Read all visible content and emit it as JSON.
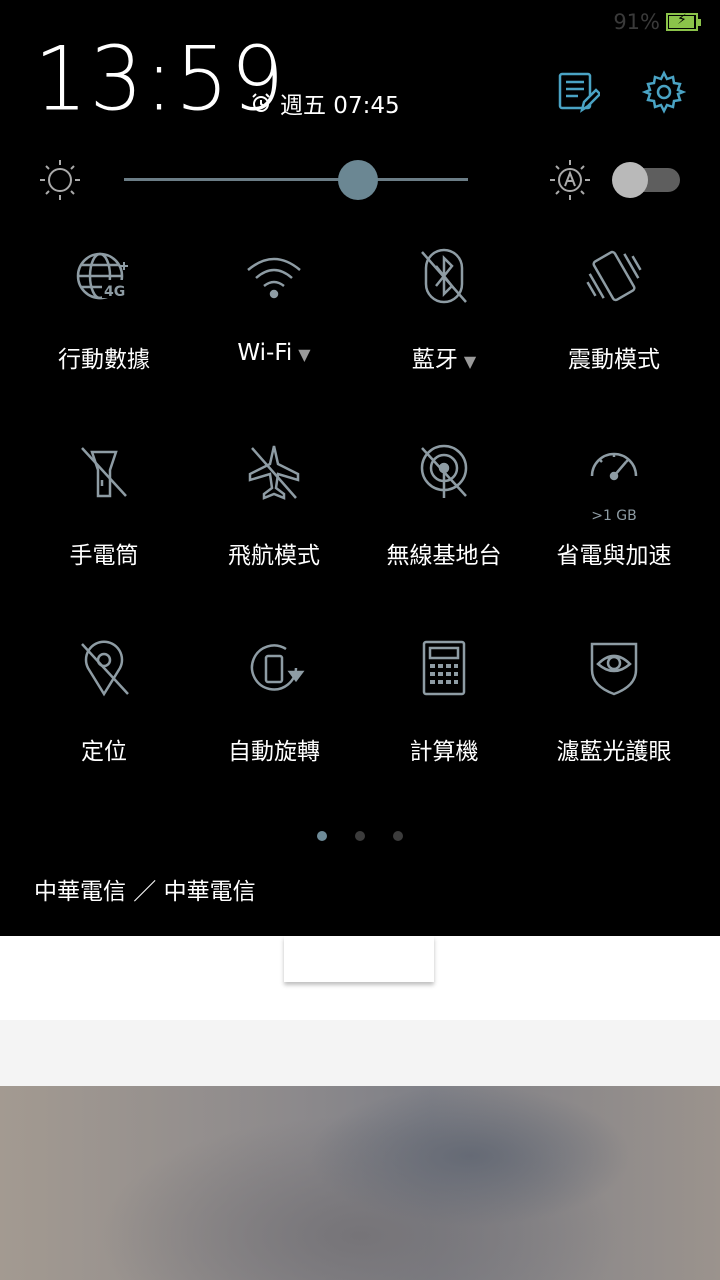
{
  "status_bar": {
    "battery_text": "91%",
    "battery_level": 0.91,
    "battery_color": "#8bc34a"
  },
  "header": {
    "time": "13:59",
    "alarm_text": "週五 07:45",
    "alarm_icon": "alarm-clock-icon",
    "edit_icon": "edit-tiles-icon",
    "settings_icon": "gear-icon",
    "accent": "#4aa3c4"
  },
  "brightness": {
    "level": 0.68,
    "auto_enabled": false
  },
  "tiles": [
    {
      "label": "行動數據",
      "icon": "mobile-data-4g-icon",
      "has_arrow": false
    },
    {
      "label": "Wi-Fi",
      "icon": "wifi-icon",
      "has_arrow": true,
      "arrow": "▼"
    },
    {
      "label": "藍牙",
      "icon": "bluetooth-off-icon",
      "has_arrow": true,
      "arrow": "▼"
    },
    {
      "label": "震動模式",
      "icon": "vibrate-icon",
      "has_arrow": false
    },
    {
      "label": "手電筒",
      "icon": "flashlight-off-icon",
      "has_arrow": false
    },
    {
      "label": "飛航模式",
      "icon": "airplane-off-icon",
      "has_arrow": false
    },
    {
      "label": "無線基地台",
      "icon": "hotspot-off-icon",
      "has_arrow": false
    },
    {
      "label": "省電與加速",
      "icon": "speedometer-icon",
      "has_arrow": false,
      "sub_text": ">1 GB"
    },
    {
      "label": "定位",
      "icon": "location-off-icon",
      "has_arrow": false
    },
    {
      "label": "自動旋轉",
      "icon": "auto-rotate-icon",
      "has_arrow": false
    },
    {
      "label": "計算機",
      "icon": "calculator-icon",
      "has_arrow": false
    },
    {
      "label": "濾藍光護眼",
      "icon": "eye-shield-icon",
      "has_arrow": false
    }
  ],
  "pager": {
    "count": 3,
    "active": 0
  },
  "carrier": "中華電信 ／ 中華電信"
}
